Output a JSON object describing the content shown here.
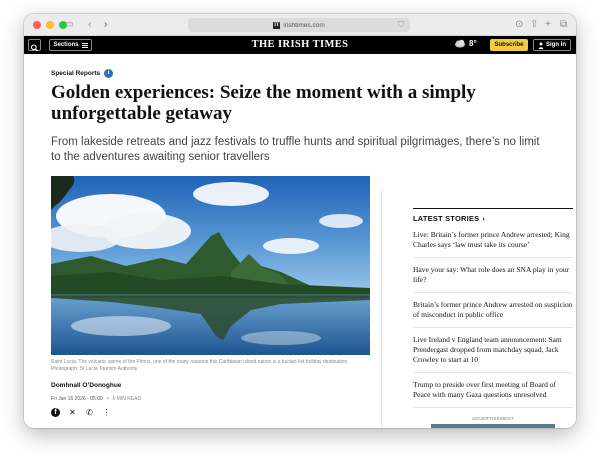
{
  "browser": {
    "url": "irishtimes.com",
    "favicon_text": "IT"
  },
  "nav": {
    "sections_label": "Sections",
    "masthead": "THE IRISH TIMES",
    "temperature": "8°",
    "subscribe_label": "Subscribe",
    "signin_label": "Sign In",
    "accent_color": "#f2cc45"
  },
  "article": {
    "kicker": "Special Reports",
    "headline": "Golden experiences: Seize the moment with a simply unforgettable getaway",
    "standfirst": "From lakeside retreats and jazz festivals to truffle hunts and spiritual pilgrimages, there’s no limit to the adventures awaiting senior travellers",
    "caption": "Saint Lucia: The volcanic spires of the Pitons, one of the many reasons this Caribbean island nation is a bucket-list holiday destination. Photograph: St Lucia Tourism Authority",
    "author": "Domhnall O’Donoghue",
    "date": "Fri Jan 16 2026 - 05:00",
    "read_time": "6 MIN READ"
  },
  "sidebar": {
    "heading": "LATEST STORIES",
    "stories": [
      "Live: Britain’s former prince Andrew arrested; King Charles says ‘law must take its course’",
      "Have your say: What role does an SNA play in your life?",
      "Britain’s former prince Andrew arrested on suspicion of misconduct in public office",
      "Live Ireland v England team announcement: Sam Prendergast dropped from matchday squad, Jack Crowley to start at 10",
      "Trump to preside over first meeting of Board of Peace with many Gaza questions unresolved"
    ],
    "ad_label": "ADVERTISEMENT"
  },
  "icons": {
    "search": "search-icon",
    "menu": "hamburger-icon",
    "weather": "cloud-icon",
    "user": "user-icon",
    "info": "info-icon",
    "share": [
      "facebook-icon",
      "x-icon",
      "whatsapp-icon",
      "more-icon"
    ]
  }
}
